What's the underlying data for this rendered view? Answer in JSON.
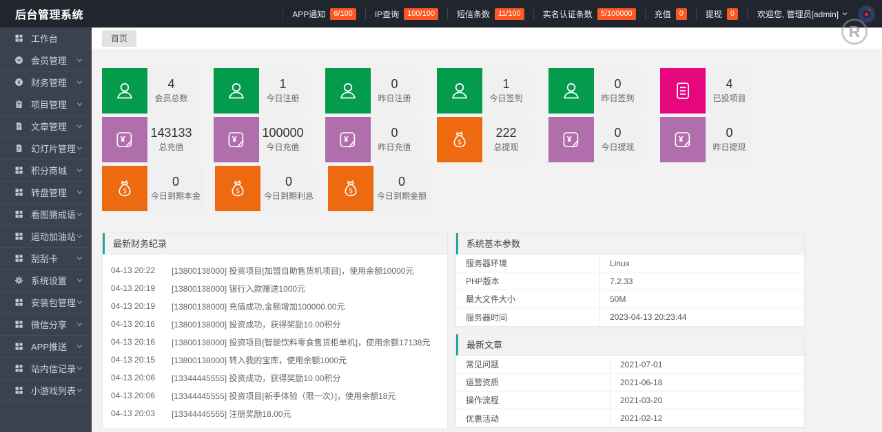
{
  "header": {
    "title": "后台管理系统",
    "stats": [
      {
        "label": "APP通知",
        "badge": "6/100"
      },
      {
        "label": "IP查询",
        "badge": "100/100"
      },
      {
        "label": "短信条数",
        "badge": "11/100"
      },
      {
        "label": "实名认证条数",
        "badge": "5/100000"
      },
      {
        "label": "充值",
        "badge": "0"
      },
      {
        "label": "提现",
        "badge": "0"
      }
    ],
    "welcome": "欢迎您, 管理员[admin]"
  },
  "watermark": "R",
  "tabs": {
    "home": "首页"
  },
  "sidebar": {
    "items": [
      {
        "label": "工作台",
        "icon": "grid",
        "expandable": false
      },
      {
        "label": "会员管理",
        "icon": "member",
        "expandable": true
      },
      {
        "label": "财务管理",
        "icon": "finance",
        "expandable": true
      },
      {
        "label": "项目管理",
        "icon": "project",
        "expandable": true
      },
      {
        "label": "文章管理",
        "icon": "article",
        "expandable": true
      },
      {
        "label": "幻灯片管理",
        "icon": "slide",
        "expandable": true
      },
      {
        "label": "积分商城",
        "icon": "grid",
        "expandable": true
      },
      {
        "label": "转盘管理",
        "icon": "grid",
        "expandable": true
      },
      {
        "label": "看图猜成语",
        "icon": "grid",
        "expandable": true
      },
      {
        "label": "运动加油站",
        "icon": "grid",
        "expandable": true
      },
      {
        "label": "刮刮卡",
        "icon": "grid",
        "expandable": true
      },
      {
        "label": "系统设置",
        "icon": "gear",
        "expandable": true
      },
      {
        "label": "安装包管理",
        "icon": "grid",
        "expandable": true
      },
      {
        "label": "微信分享",
        "icon": "grid",
        "expandable": true
      },
      {
        "label": "APP推送",
        "icon": "grid",
        "expandable": true
      },
      {
        "label": "站内信记录",
        "icon": "grid",
        "expandable": true
      },
      {
        "label": "小游戏列表",
        "icon": "grid",
        "expandable": true
      }
    ]
  },
  "cards": {
    "row1": [
      {
        "value": "4",
        "label": "会员总数",
        "icon": "user",
        "color": "#049B4C"
      },
      {
        "value": "1",
        "label": "今日注册",
        "icon": "user",
        "color": "#049B4C"
      },
      {
        "value": "0",
        "label": "昨日注册",
        "icon": "user",
        "color": "#049B4C"
      },
      {
        "value": "1",
        "label": "今日签到",
        "icon": "user",
        "color": "#049B4C"
      },
      {
        "value": "0",
        "label": "昨日签到",
        "icon": "user",
        "color": "#049B4C"
      },
      {
        "value": "4",
        "label": "已投项目",
        "icon": "invest-list",
        "color": "#E6077F"
      }
    ],
    "row2": [
      {
        "value": "143133",
        "label": "总充值",
        "icon": "yen-card",
        "color": "#B06FAC"
      },
      {
        "value": "100000",
        "label": "今日充值",
        "icon": "yen-card",
        "color": "#B06FAC"
      },
      {
        "value": "0",
        "label": "昨日充值",
        "icon": "yen-card",
        "color": "#B06FAC"
      },
      {
        "value": "222",
        "label": "总提现",
        "icon": "money-bag",
        "color": "#EE6A10"
      },
      {
        "value": "0",
        "label": "今日提现",
        "icon": "yen-card",
        "color": "#B06FAC"
      },
      {
        "value": "0",
        "label": "昨日提现",
        "icon": "yen-card",
        "color": "#B06FAC"
      }
    ],
    "row3": [
      {
        "value": "0",
        "label": "今日到期本金",
        "icon": "money-bag",
        "color": "#EE6A10"
      },
      {
        "value": "0",
        "label": "今日到期利息",
        "icon": "money-bag",
        "color": "#EE6A10"
      },
      {
        "value": "0",
        "label": "今日到期金额",
        "icon": "money-bag",
        "color": "#EE6A10"
      }
    ]
  },
  "records": {
    "title": "最新财务纪录",
    "items": [
      {
        "time": "04-13 20:22",
        "text": "[13800138000] 投资项目[加盟自助售货机项目]，使用余额10000元"
      },
      {
        "time": "04-13 20:19",
        "text": "[13800138000] 银行入款赠送1000元"
      },
      {
        "time": "04-13 20:19",
        "text": "[13800138000] 充值成功,金额增加100000.00元"
      },
      {
        "time": "04-13 20:16",
        "text": "[13800138000] 投资成功，获得奖励10.00积分"
      },
      {
        "time": "04-13 20:16",
        "text": "[13800138000] 投资项目[智能饮料零食售货柜单机]，使用余额17138元"
      },
      {
        "time": "04-13 20:15",
        "text": "[13800138000] 转入我的宝库，使用余额1000元"
      },
      {
        "time": "04-13 20:06",
        "text": "[13344445555] 投资成功，获得奖励10.00积分"
      },
      {
        "time": "04-13 20:06",
        "text": "[13344445555] 投资项目[新手体验（限一次）]，使用余额18元"
      },
      {
        "time": "04-13 20:03",
        "text": "[13344445555] 注册奖励18.00元"
      }
    ]
  },
  "system": {
    "title": "系统基本参数",
    "rows": [
      {
        "label": "服务器环境",
        "value": "Linux"
      },
      {
        "label": "PHP版本",
        "value": "7.2.33"
      },
      {
        "label": "最大文件大小",
        "value": "50M"
      },
      {
        "label": "服务器时间",
        "value": "2023-04-13 20:23:44"
      }
    ]
  },
  "articles": {
    "title": "最新文章",
    "rows": [
      {
        "label": "常见问题",
        "value": "2021-07-01"
      },
      {
        "label": "运营资质",
        "value": "2021-06-18"
      },
      {
        "label": "操作流程",
        "value": "2021-03-20"
      },
      {
        "label": "优惠活动",
        "value": "2021-02-12"
      }
    ]
  },
  "colors": {
    "accent": "#23A695",
    "badge": "#FF5722"
  }
}
